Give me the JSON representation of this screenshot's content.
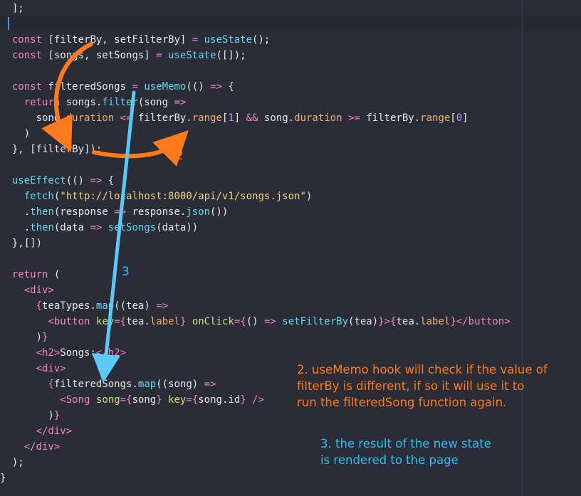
{
  "code_lines": [
    [
      {
        "t": "  ];",
        "c": "plain"
      }
    ],
    [],
    [
      {
        "t": "  ",
        "c": "plain"
      },
      {
        "t": "const",
        "c": "keyword"
      },
      {
        "t": " [filterBy, setFilterBy] ",
        "c": "plain"
      },
      {
        "t": "=",
        "c": "keyword"
      },
      {
        "t": " ",
        "c": "plain"
      },
      {
        "t": "useState",
        "c": "func"
      },
      {
        "t": "();",
        "c": "plain"
      }
    ],
    [
      {
        "t": "  ",
        "c": "plain"
      },
      {
        "t": "const",
        "c": "keyword"
      },
      {
        "t": " [songs, setSongs] ",
        "c": "plain"
      },
      {
        "t": "=",
        "c": "keyword"
      },
      {
        "t": " ",
        "c": "plain"
      },
      {
        "t": "useState",
        "c": "func"
      },
      {
        "t": "([]);",
        "c": "plain"
      }
    ],
    [],
    [
      {
        "t": "  ",
        "c": "plain"
      },
      {
        "t": "const",
        "c": "keyword"
      },
      {
        "t": " filteredSongs ",
        "c": "plain"
      },
      {
        "t": "=",
        "c": "keyword"
      },
      {
        "t": " ",
        "c": "plain"
      },
      {
        "t": "useMemo",
        "c": "func"
      },
      {
        "t": "(() ",
        "c": "plain"
      },
      {
        "t": "=>",
        "c": "keyword"
      },
      {
        "t": " {",
        "c": "plain"
      }
    ],
    [
      {
        "t": "    ",
        "c": "plain"
      },
      {
        "t": "return",
        "c": "keyword"
      },
      {
        "t": " songs.",
        "c": "plain"
      },
      {
        "t": "filter",
        "c": "func"
      },
      {
        "t": "(song ",
        "c": "plain"
      },
      {
        "t": "=>",
        "c": "keyword"
      }
    ],
    [
      {
        "t": "      song.",
        "c": "plain"
      },
      {
        "t": "duration",
        "c": "prop"
      },
      {
        "t": " ",
        "c": "plain"
      },
      {
        "t": "<=",
        "c": "keyword"
      },
      {
        "t": " filterBy.",
        "c": "plain"
      },
      {
        "t": "range",
        "c": "prop"
      },
      {
        "t": "[",
        "c": "plain"
      },
      {
        "t": "1",
        "c": "number"
      },
      {
        "t": "] ",
        "c": "plain"
      },
      {
        "t": "&&",
        "c": "keyword"
      },
      {
        "t": " song.",
        "c": "plain"
      },
      {
        "t": "duration",
        "c": "prop"
      },
      {
        "t": " ",
        "c": "plain"
      },
      {
        "t": ">=",
        "c": "keyword"
      },
      {
        "t": " filterBy.",
        "c": "plain"
      },
      {
        "t": "range",
        "c": "prop"
      },
      {
        "t": "[",
        "c": "plain"
      },
      {
        "t": "0",
        "c": "number"
      },
      {
        "t": "]",
        "c": "plain"
      }
    ],
    [
      {
        "t": "    )",
        "c": "plain"
      }
    ],
    [
      {
        "t": "  }, [filterBy]);",
        "c": "plain"
      }
    ],
    [],
    [
      {
        "t": "  ",
        "c": "plain"
      },
      {
        "t": "useEffect",
        "c": "func"
      },
      {
        "t": "(() ",
        "c": "plain"
      },
      {
        "t": "=>",
        "c": "keyword"
      },
      {
        "t": " {",
        "c": "plain"
      }
    ],
    [
      {
        "t": "    ",
        "c": "plain"
      },
      {
        "t": "fetch",
        "c": "func"
      },
      {
        "t": "(",
        "c": "plain"
      },
      {
        "t": "\"http://localhost:8000/api/v1/songs.json\"",
        "c": "string"
      },
      {
        "t": ")",
        "c": "plain"
      }
    ],
    [
      {
        "t": "    .",
        "c": "plain"
      },
      {
        "t": "then",
        "c": "func"
      },
      {
        "t": "(response ",
        "c": "plain"
      },
      {
        "t": "=>",
        "c": "keyword"
      },
      {
        "t": " response.",
        "c": "plain"
      },
      {
        "t": "json",
        "c": "func"
      },
      {
        "t": "())",
        "c": "plain"
      }
    ],
    [
      {
        "t": "    .",
        "c": "plain"
      },
      {
        "t": "then",
        "c": "func"
      },
      {
        "t": "(data ",
        "c": "plain"
      },
      {
        "t": "=>",
        "c": "keyword"
      },
      {
        "t": " ",
        "c": "plain"
      },
      {
        "t": "setSongs",
        "c": "func"
      },
      {
        "t": "(data))",
        "c": "plain"
      }
    ],
    [
      {
        "t": "  },[])",
        "c": "plain"
      }
    ],
    [],
    [
      {
        "t": "  ",
        "c": "plain"
      },
      {
        "t": "return",
        "c": "keyword"
      },
      {
        "t": " (",
        "c": "plain"
      }
    ],
    [
      {
        "t": "    ",
        "c": "plain"
      },
      {
        "t": "<div>",
        "c": "tag"
      }
    ],
    [
      {
        "t": "      ",
        "c": "plain"
      },
      {
        "t": "{",
        "c": "brace"
      },
      {
        "t": "teaTypes.",
        "c": "plain"
      },
      {
        "t": "map",
        "c": "func"
      },
      {
        "t": "((tea) ",
        "c": "plain"
      },
      {
        "t": "=>",
        "c": "keyword"
      }
    ],
    [
      {
        "t": "        ",
        "c": "plain"
      },
      {
        "t": "<button",
        "c": "tag"
      },
      {
        "t": " ",
        "c": "plain"
      },
      {
        "t": "key",
        "c": "attr"
      },
      {
        "t": "=",
        "c": "keyword"
      },
      {
        "t": "{",
        "c": "brace"
      },
      {
        "t": "tea.",
        "c": "plain"
      },
      {
        "t": "label",
        "c": "prop"
      },
      {
        "t": "}",
        "c": "brace"
      },
      {
        "t": " ",
        "c": "plain"
      },
      {
        "t": "onClick",
        "c": "attr"
      },
      {
        "t": "=",
        "c": "keyword"
      },
      {
        "t": "{",
        "c": "brace"
      },
      {
        "t": "() ",
        "c": "plain"
      },
      {
        "t": "=>",
        "c": "keyword"
      },
      {
        "t": " ",
        "c": "plain"
      },
      {
        "t": "setFilterBy",
        "c": "func"
      },
      {
        "t": "(tea)",
        "c": "plain"
      },
      {
        "t": "}",
        "c": "brace"
      },
      {
        "t": ">",
        "c": "tag"
      },
      {
        "t": "{",
        "c": "brace"
      },
      {
        "t": "tea.",
        "c": "plain"
      },
      {
        "t": "label",
        "c": "prop"
      },
      {
        "t": "}",
        "c": "brace"
      },
      {
        "t": "</button>",
        "c": "tag"
      }
    ],
    [
      {
        "t": "      )",
        "c": "plain"
      },
      {
        "t": "}",
        "c": "brace"
      }
    ],
    [
      {
        "t": "      ",
        "c": "plain"
      },
      {
        "t": "<h2>",
        "c": "tag"
      },
      {
        "t": "Songs:",
        "c": "plain"
      },
      {
        "t": "</h2>",
        "c": "tag"
      }
    ],
    [
      {
        "t": "      ",
        "c": "plain"
      },
      {
        "t": "<div>",
        "c": "tag"
      }
    ],
    [
      {
        "t": "        ",
        "c": "plain"
      },
      {
        "t": "{",
        "c": "brace"
      },
      {
        "t": "filteredSongs.",
        "c": "plain"
      },
      {
        "t": "map",
        "c": "func"
      },
      {
        "t": "((song) ",
        "c": "plain"
      },
      {
        "t": "=>",
        "c": "keyword"
      }
    ],
    [
      {
        "t": "          ",
        "c": "plain"
      },
      {
        "t": "<Song",
        "c": "tag"
      },
      {
        "t": " ",
        "c": "plain"
      },
      {
        "t": "song",
        "c": "attr"
      },
      {
        "t": "=",
        "c": "keyword"
      },
      {
        "t": "{",
        "c": "brace"
      },
      {
        "t": "song",
        "c": "plain"
      },
      {
        "t": "}",
        "c": "brace"
      },
      {
        "t": " ",
        "c": "plain"
      },
      {
        "t": "key",
        "c": "attr"
      },
      {
        "t": "=",
        "c": "keyword"
      },
      {
        "t": "{",
        "c": "brace"
      },
      {
        "t": "song.id",
        "c": "plain"
      },
      {
        "t": "}",
        "c": "brace"
      },
      {
        "t": " ",
        "c": "plain"
      },
      {
        "t": "/>",
        "c": "tag"
      }
    ],
    [
      {
        "t": "        )",
        "c": "plain"
      },
      {
        "t": "}",
        "c": "brace"
      }
    ],
    [
      {
        "t": "      ",
        "c": "plain"
      },
      {
        "t": "</div>",
        "c": "tag"
      }
    ],
    [
      {
        "t": "    ",
        "c": "plain"
      },
      {
        "t": "</div>",
        "c": "tag"
      }
    ],
    [
      {
        "t": "  );",
        "c": "plain"
      }
    ],
    [
      {
        "t": "}",
        "c": "plain"
      }
    ]
  ],
  "annotations": {
    "marker_2": "2",
    "marker_3": "3",
    "note_2": "2. useMemo hook will check if the value of\nfilterBy is different, if so it will use it to\nrun the filteredSong function again.",
    "note_3": "3. the result of the new state\nis rendered to the page"
  },
  "colors": {
    "background": "#2a2c37",
    "annotation_orange": "#ff7a1a",
    "annotation_blue": "#5cc8f5"
  }
}
